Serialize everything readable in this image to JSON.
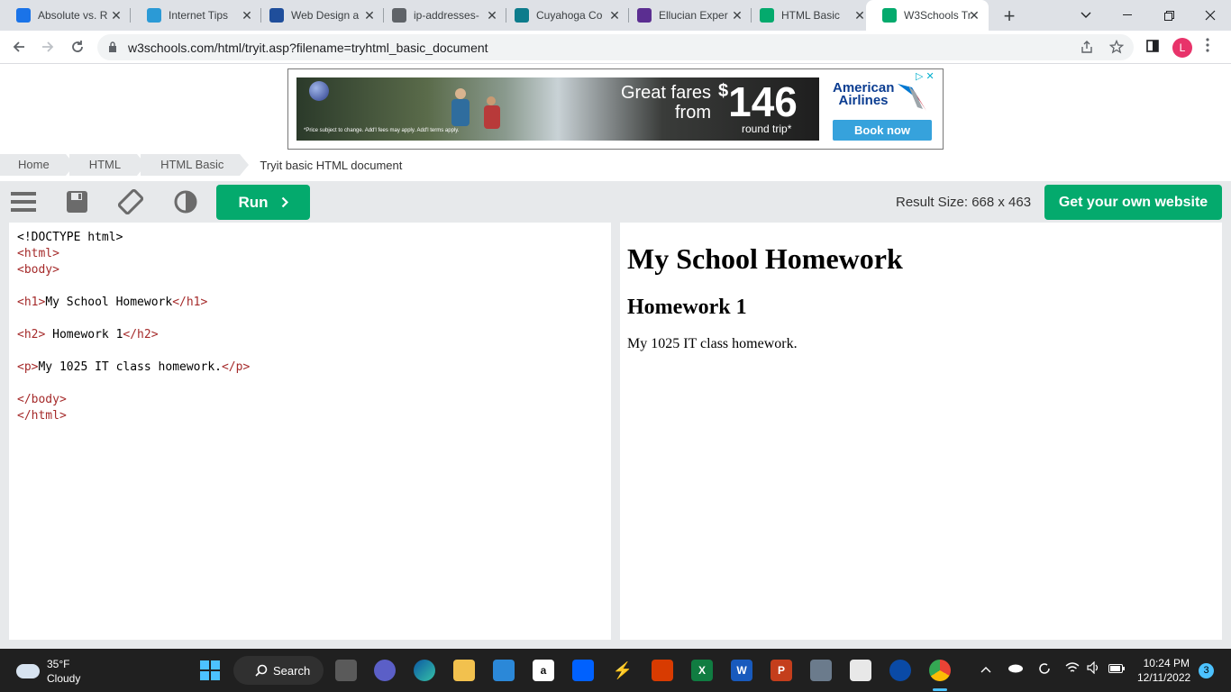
{
  "browser": {
    "tabs": [
      {
        "title": "Absolute vs. R",
        "icon": "doc-icon",
        "color": "#1a73e8"
      },
      {
        "title": "Internet Tips",
        "icon": "edge-icon",
        "color": "#2b9ad6"
      },
      {
        "title": "Web Design a",
        "icon": "w3-icon",
        "color": "#1f4e9b"
      },
      {
        "title": "ip-addresses-",
        "icon": "link-icon",
        "color": "#5f6368"
      },
      {
        "title": "Cuyahoga Co",
        "icon": "tri-c-icon",
        "color": "#0d7c8c"
      },
      {
        "title": "Ellucian Exper",
        "icon": "ellucian-icon",
        "color": "#5b2e91"
      },
      {
        "title": "HTML Basic",
        "icon": "w3schools-icon",
        "color": "#04aa6d"
      },
      {
        "title": "W3Schools Tr",
        "icon": "w3schools-icon",
        "color": "#04aa6d"
      }
    ],
    "url": "w3schools.com/html/tryit.asp?filename=tryhtml_basic_document",
    "profile_initial": "L"
  },
  "ad": {
    "headline": "Great fares from",
    "price": "146",
    "currency": "$",
    "price_note": "round trip*",
    "fine_print": "*Price subject to change. Add'l fees may apply. Add'l terms apply.",
    "brand": "American Airlines",
    "cta": "Book now"
  },
  "breadcrumb": [
    "Home",
    "HTML",
    "HTML Basic"
  ],
  "breadcrumb_current": "Tryit basic HTML document",
  "toolbar": {
    "run_label": "Run",
    "result_size": "Result Size: 668 x 463",
    "get_website": "Get your own website"
  },
  "code_lines": [
    "<!DOCTYPE html>",
    "<html>",
    "<body>",
    "",
    "<h1>My School Homework</h1>",
    "",
    "<h2> Homework 1</h2>",
    "",
    "<p>My 1025 IT class homework.</p>",
    "",
    "</body>",
    "</html>"
  ],
  "result": {
    "h1": "My School Homework",
    "h2": "Homework 1",
    "p": "My 1025 IT class homework."
  },
  "taskbar": {
    "temp": "35°F",
    "condition": "Cloudy",
    "search_label": "Search",
    "time": "10:24 PM",
    "date": "12/11/2022",
    "notifications": "3"
  }
}
